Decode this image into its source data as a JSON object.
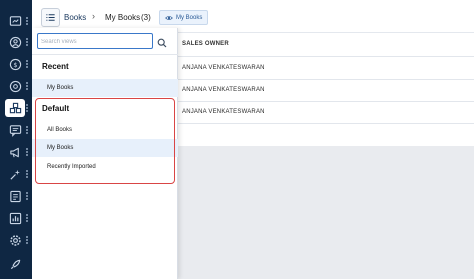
{
  "header": {
    "module": "Books",
    "separator": "›",
    "current_view": "My Books",
    "count": "(3)",
    "chip_label": "My Books"
  },
  "views_panel": {
    "search_placeholder": "Search views",
    "recent": {
      "title": "Recent",
      "items": [
        "My Books"
      ]
    },
    "default": {
      "title": "Default",
      "items": [
        "All Books",
        "My Books",
        "Recently Imported"
      ],
      "selected": "My Books"
    }
  },
  "table": {
    "columns": [
      "SALES OWNER"
    ],
    "rows": [
      [
        "ANJANA VENKATESWARAN"
      ],
      [
        "ANJANA VENKATESWARAN"
      ],
      [
        "ANJANA VENKATESWARAN"
      ]
    ]
  },
  "left_nav": {
    "icons": [
      "dashboard-icon",
      "contacts-icon",
      "deals-icon",
      "catalog-icon",
      "conversations-icon",
      "campaigns-icon",
      "automation-icon",
      "notes-icon",
      "reports-icon",
      "settings-icon",
      "launch-icon"
    ],
    "active": "catalog-icon"
  },
  "colors": {
    "nav_bg": "#0f2743",
    "accent": "#3a78c9",
    "highlight": "#d94545",
    "selected_row": "#e7f0fb"
  }
}
